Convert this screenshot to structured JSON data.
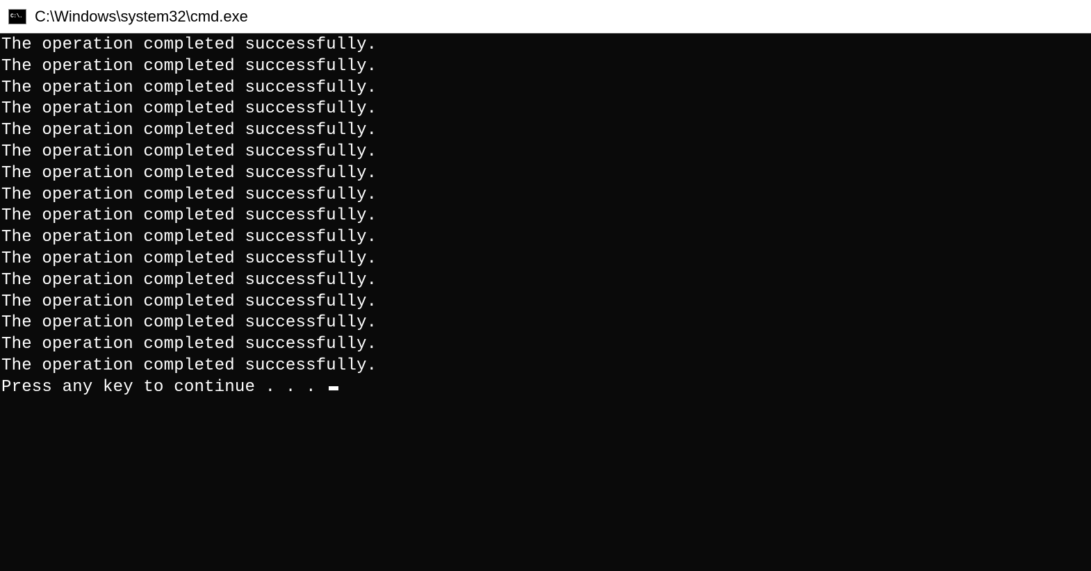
{
  "window": {
    "title": "C:\\Windows\\system32\\cmd.exe",
    "icon_label": "C:\\."
  },
  "terminal": {
    "lines": [
      "The operation completed successfully.",
      "The operation completed successfully.",
      "The operation completed successfully.",
      "The operation completed successfully.",
      "The operation completed successfully.",
      "The operation completed successfully.",
      "The operation completed successfully.",
      "The operation completed successfully.",
      "The operation completed successfully.",
      "The operation completed successfully.",
      "The operation completed successfully.",
      "The operation completed successfully.",
      "The operation completed successfully.",
      "The operation completed successfully.",
      "The operation completed successfully.",
      "The operation completed successfully."
    ],
    "prompt": "Press any key to continue . . . "
  }
}
